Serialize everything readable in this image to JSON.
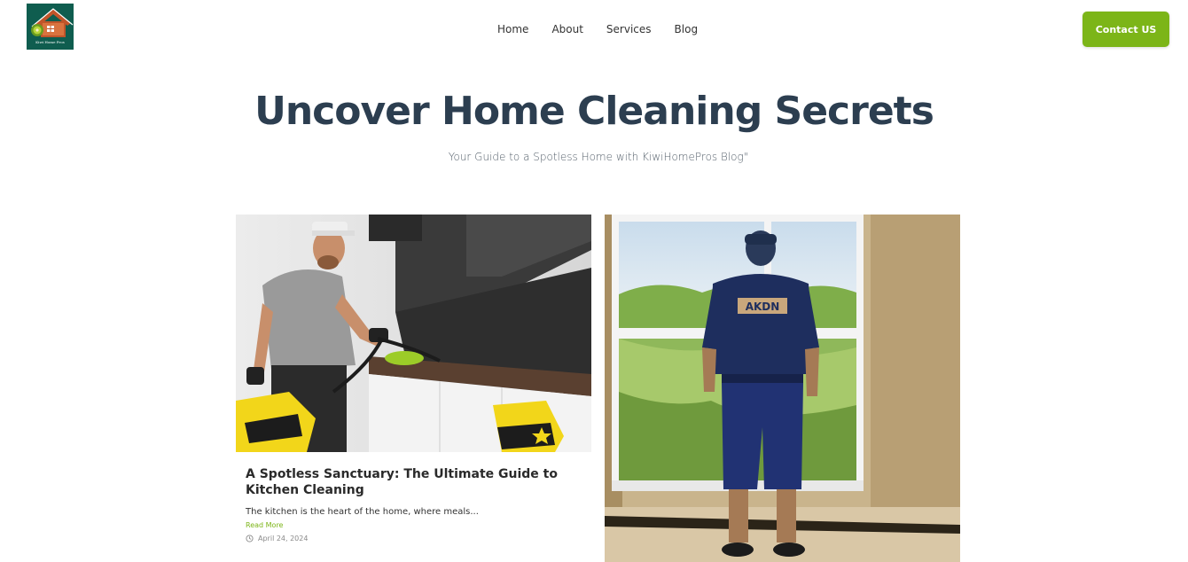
{
  "brand": {
    "logo_text": "Kiwi Home Pros",
    "colors": {
      "logo_bg": "#0f5d4f",
      "accent": "#7cb518",
      "heading": "#2c3e50"
    }
  },
  "nav": {
    "items": [
      {
        "label": "Home"
      },
      {
        "label": "About"
      },
      {
        "label": "Services"
      },
      {
        "label": "Blog"
      }
    ],
    "contact_label": "Contact US"
  },
  "hero": {
    "title": "Uncover Home Cleaning Secrets",
    "subtitle": "Your Guide to a Spotless Home with KiwiHomePros Blog\""
  },
  "posts": [
    {
      "image_icon": "kitchen-cleaning-photo",
      "title": "A Spotless Sanctuary: The Ultimate Guide to Kitchen Cleaning",
      "excerpt": "The kitchen is the heart of the home, where meals...",
      "read_more": "Read More",
      "date": "April 24, 2024"
    },
    {
      "image_icon": "window-worker-photo",
      "shirt_text": "AKDN"
    }
  ]
}
